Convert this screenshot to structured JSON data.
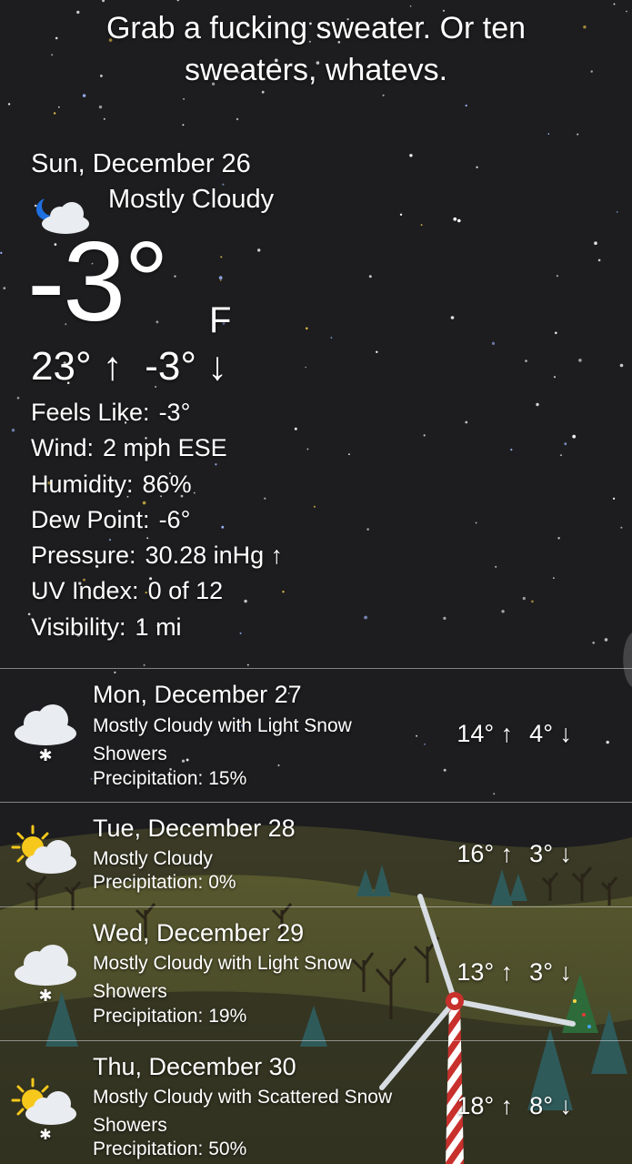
{
  "headline": "Grab a fucking sweater. Or ten sweaters, whatevs.",
  "current": {
    "date": "Sun, December 26",
    "condition": "Mostly Cloudy",
    "condition_icon": "night-partly-cloudy-icon",
    "temperature": "-3°",
    "unit": "F",
    "high": "23° ↑",
    "low": "-3° ↓",
    "details": [
      {
        "label": "Feels Like:",
        "value": "-3°"
      },
      {
        "label": "Wind:",
        "value": "2 mph ESE"
      },
      {
        "label": "Humidity:",
        "value": "86%"
      },
      {
        "label": "Dew Point:",
        "value": "-6°"
      },
      {
        "label": "Pressure:",
        "value": "30.28 inHg ↑"
      },
      {
        "label": "UV Index:",
        "value": "0 of 12"
      },
      {
        "label": "Visibility:",
        "value": "1 mi"
      }
    ]
  },
  "forecast": [
    {
      "day": "Mon, December 27",
      "desc": "Mostly Cloudy with Light Snow Showers",
      "precip": "Precipitation:  15%",
      "high": "14° ↑",
      "low": "4° ↓",
      "icon": "cloud-snow-icon"
    },
    {
      "day": "Tue, December 28",
      "desc": "Mostly Cloudy",
      "precip": "Precipitation:  0%",
      "high": "16° ↑",
      "low": "3° ↓",
      "icon": "sun-cloud-icon"
    },
    {
      "day": "Wed, December 29",
      "desc": "Mostly Cloudy with Light Snow Showers",
      "precip": "Precipitation:  19%",
      "high": "13° ↑",
      "low": "3° ↓",
      "icon": "cloud-snow-icon"
    },
    {
      "day": "Thu, December 30",
      "desc": "Mostly Cloudy with Scattered Snow Showers",
      "precip": "Precipitation:  50%",
      "high": "18° ↑",
      "low": "8° ↓",
      "icon": "sun-cloud-snow-icon"
    }
  ],
  "colors": {
    "sky": "#1d1d1f",
    "hill_dark": "#3d3d27",
    "hill_light": "#5a5a2d",
    "sun": "#f6c81b",
    "cloud": "#e9ecf0",
    "moon": "#1e6fe0",
    "windmill_pole": "#c8302c"
  }
}
